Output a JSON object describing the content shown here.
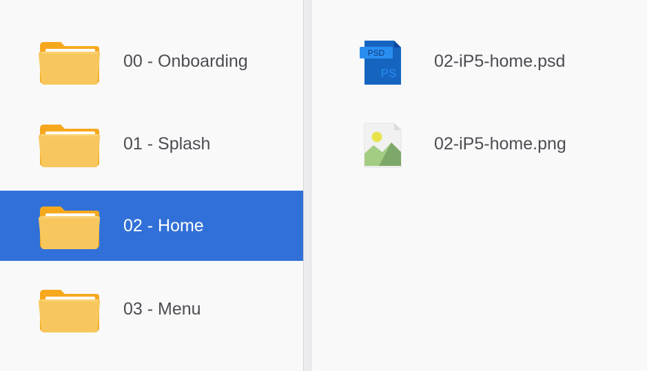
{
  "folders": [
    {
      "label": "00 - Onboarding",
      "icon": "folder-icon",
      "selected": false
    },
    {
      "label": "01 - Splash",
      "icon": "folder-icon",
      "selected": false
    },
    {
      "label": "02 - Home",
      "icon": "folder-icon",
      "selected": true
    },
    {
      "label": "03 - Menu",
      "icon": "folder-icon",
      "selected": false
    }
  ],
  "files": [
    {
      "label": "02-iP5-home.psd",
      "icon": "psd-file-icon",
      "badge": "PSD",
      "mark": "PS"
    },
    {
      "label": "02-iP5-home.png",
      "icon": "image-file-icon"
    }
  ],
  "colors": {
    "selection": "#3170d8",
    "background": "#f9f9fa",
    "folder": "#f7c75e",
    "folder_back": "#f6a81d",
    "psd": "#1565c0"
  }
}
